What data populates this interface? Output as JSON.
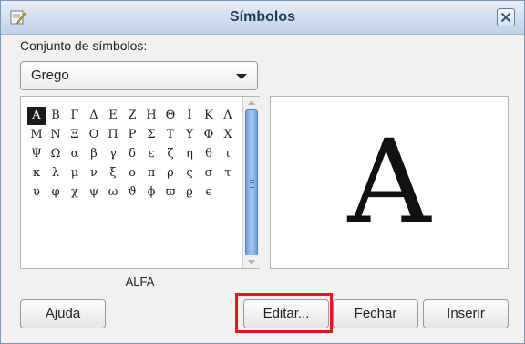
{
  "window": {
    "title": "Símbolos"
  },
  "symbol_set": {
    "label": "Conjunto de símbolos:",
    "selected": "Grego"
  },
  "symbols": [
    [
      "Α",
      "Β",
      "Γ",
      "Δ",
      "Ε",
      "Ζ",
      "Η",
      "Θ",
      "Ι",
      "Κ",
      "Λ"
    ],
    [
      "Μ",
      "Ν",
      "Ξ",
      "Ο",
      "Π",
      "Ρ",
      "Σ",
      "Τ",
      "Υ",
      "Φ",
      "Χ"
    ],
    [
      "Ψ",
      "Ω",
      "α",
      "β",
      "γ",
      "δ",
      "ε",
      "ζ",
      "η",
      "θ",
      "ι"
    ],
    [
      "κ",
      "λ",
      "μ",
      "ν",
      "ξ",
      "ο",
      "π",
      "ρ",
      "ς",
      "σ",
      "τ"
    ],
    [
      "υ",
      "φ",
      "χ",
      "ψ",
      "ω",
      "ϑ",
      "ϕ",
      "ϖ",
      "ϱ",
      "ϵ"
    ]
  ],
  "selected_symbol": "Α",
  "selected_name": "ALFA",
  "buttons": {
    "help": "Ajuda",
    "edit": "Editar...",
    "close": "Fechar",
    "insert": "Inserir"
  },
  "colors": {
    "highlight": "#e8141c",
    "scroll_thumb": "#8fb6e8",
    "selection": "#1a1a1a"
  }
}
